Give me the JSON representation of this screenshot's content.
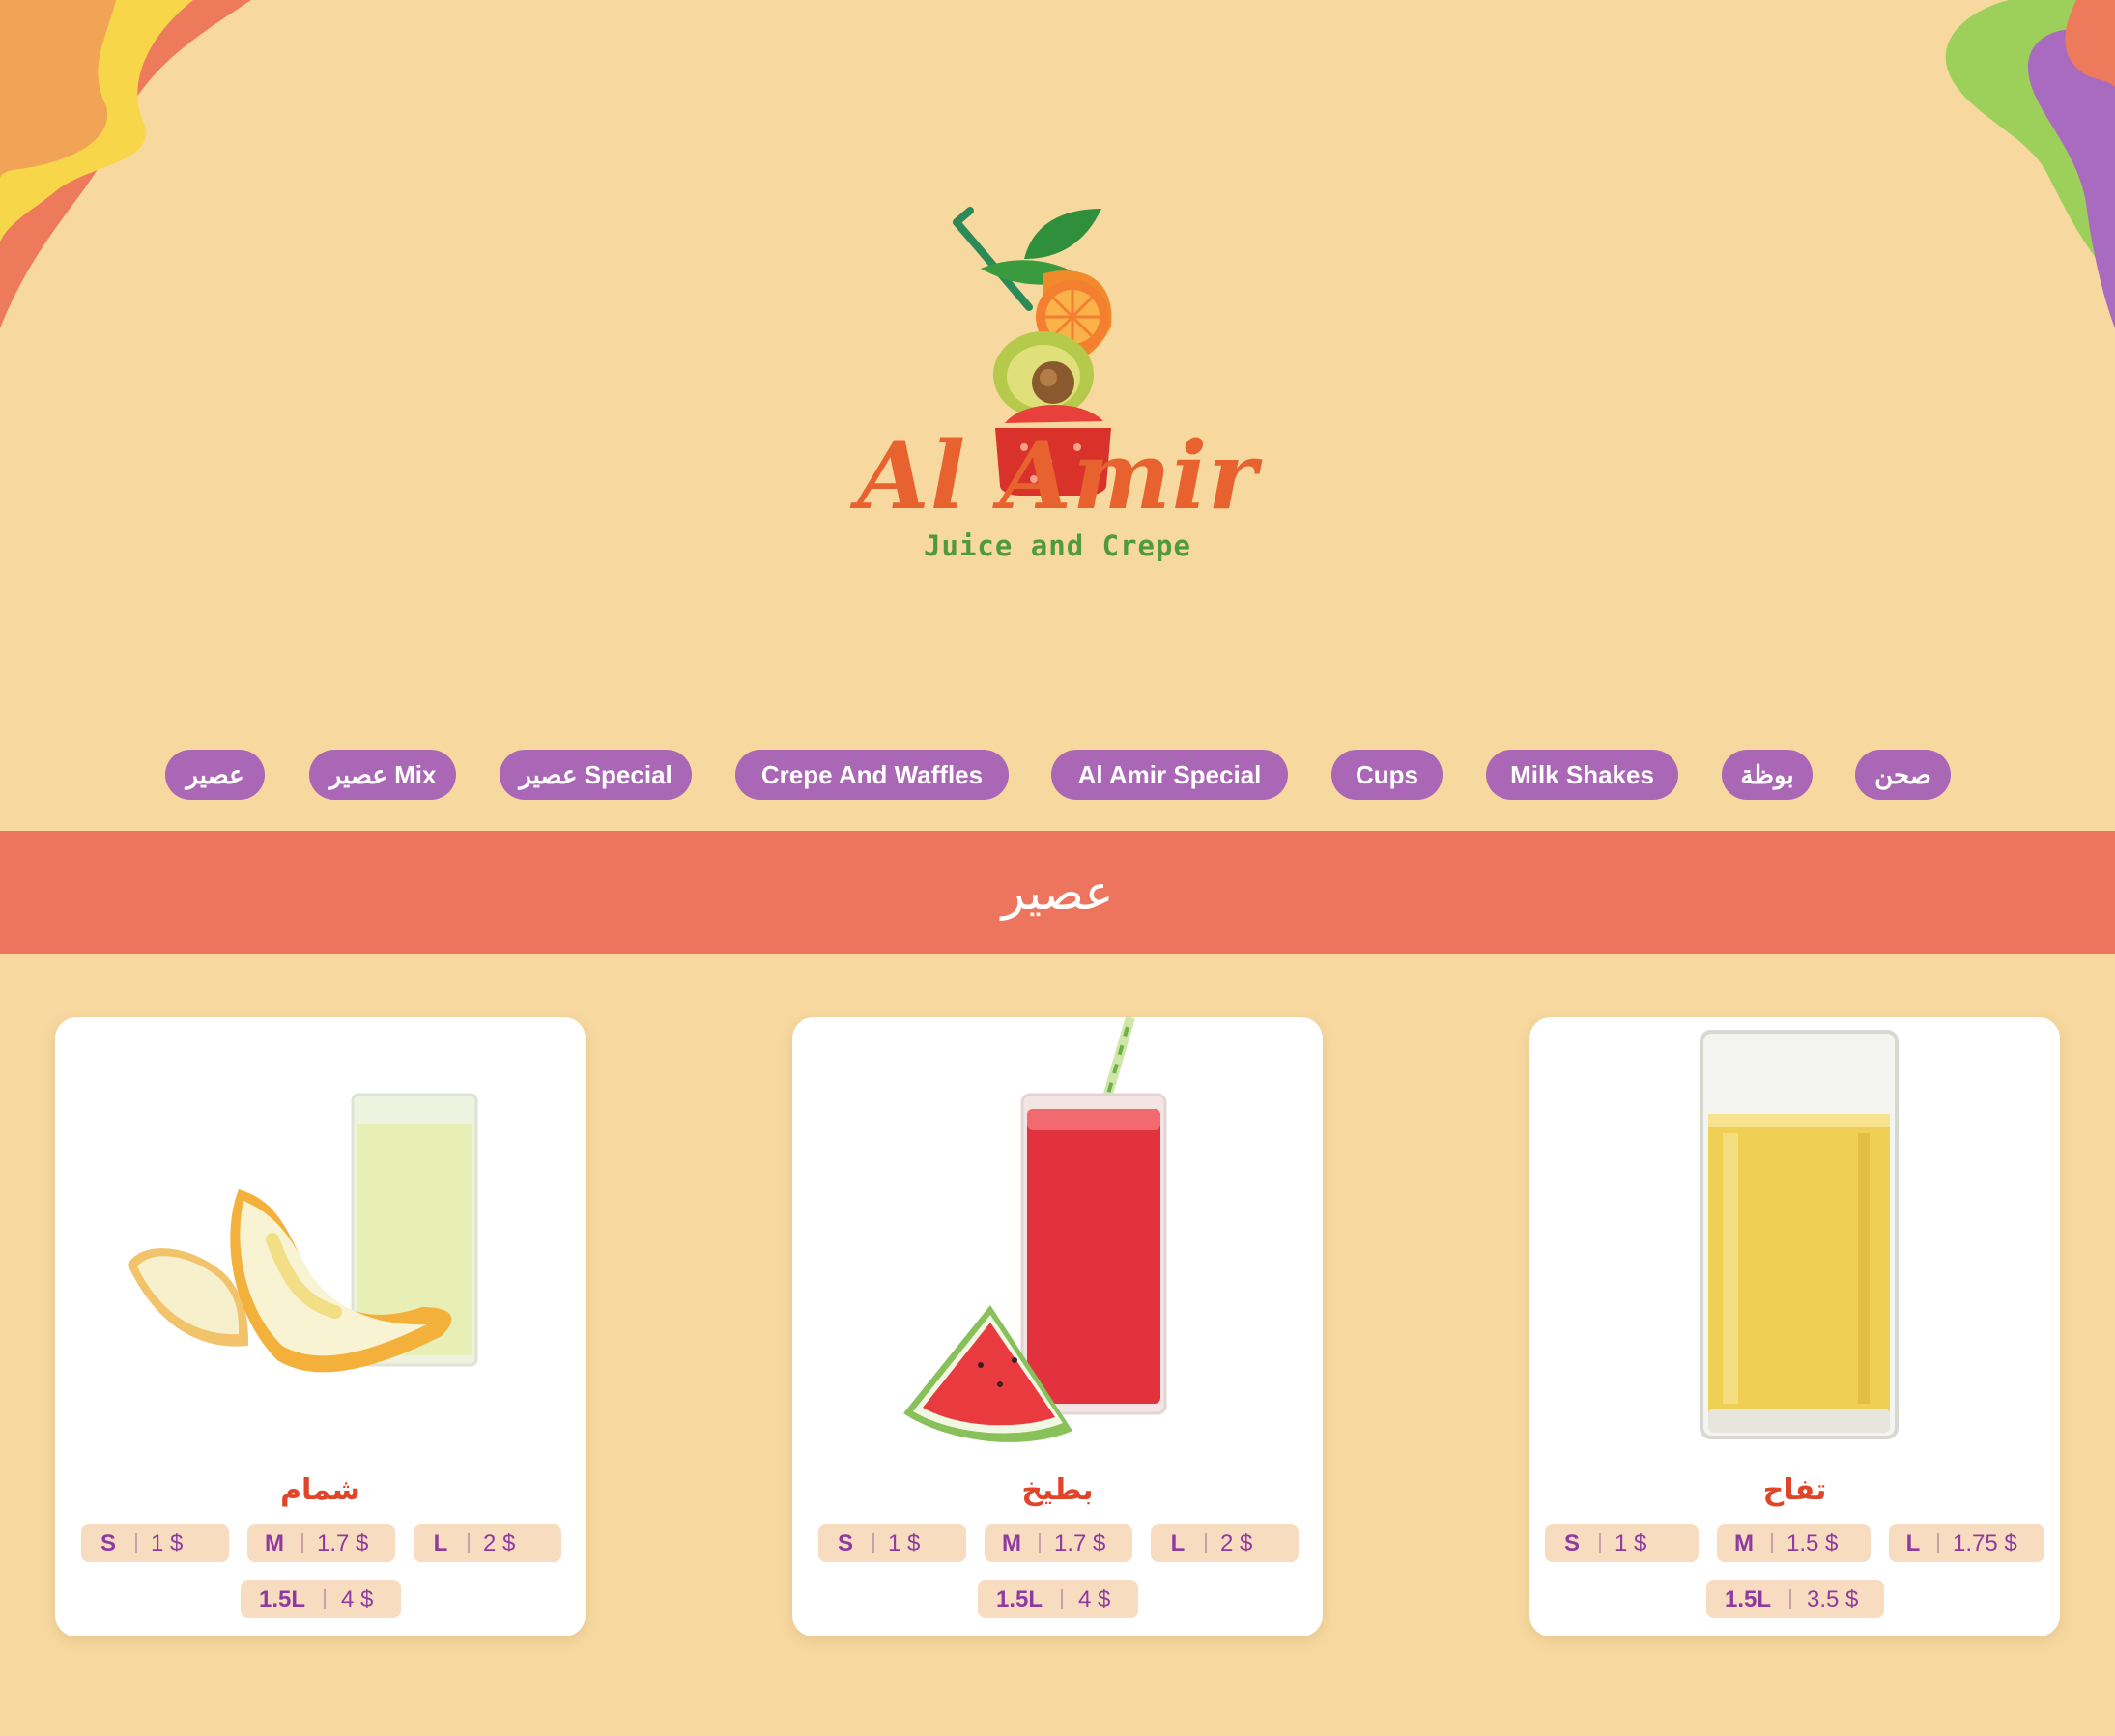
{
  "brand": {
    "name": "Al Amir",
    "tagline": "Juice and Crepe"
  },
  "nav": {
    "items": [
      {
        "label": "عصير"
      },
      {
        "label": "عصير Mix"
      },
      {
        "label": "عصير Special"
      },
      {
        "label": "Crepe And Waffles"
      },
      {
        "label": "Al Amir Special"
      },
      {
        "label": "Cups"
      },
      {
        "label": "Milk Shakes"
      },
      {
        "label": "بوظة"
      },
      {
        "label": "صحن"
      }
    ]
  },
  "section": {
    "title": "عصير"
  },
  "products": [
    {
      "name": "شمام",
      "image_icon": "melon-juice-image",
      "prices": [
        {
          "size": "S",
          "price": "1 $"
        },
        {
          "size": "M",
          "price": "1.7 $"
        },
        {
          "size": "L",
          "price": "2 $"
        },
        {
          "size": "1.5L",
          "price": "4 $"
        }
      ]
    },
    {
      "name": "بطيخ",
      "image_icon": "watermelon-juice-image",
      "prices": [
        {
          "size": "S",
          "price": "1 $"
        },
        {
          "size": "M",
          "price": "1.7 $"
        },
        {
          "size": "L",
          "price": "2 $"
        },
        {
          "size": "1.5L",
          "price": "4 $"
        }
      ]
    },
    {
      "name": "تفاح",
      "image_icon": "apple-juice-image",
      "prices": [
        {
          "size": "S",
          "price": "1 $"
        },
        {
          "size": "M",
          "price": "1.5 $"
        },
        {
          "size": "L",
          "price": "1.75 $"
        },
        {
          "size": "1.5L",
          "price": "3.5 $"
        }
      ]
    }
  ],
  "colors": {
    "background": "#f7d9a0",
    "pill": "#a967b5",
    "banner": "#ee755d",
    "product_name": "#e0452a",
    "chip_bg": "#f8dcc0",
    "chip_text": "#8e3aa0"
  }
}
